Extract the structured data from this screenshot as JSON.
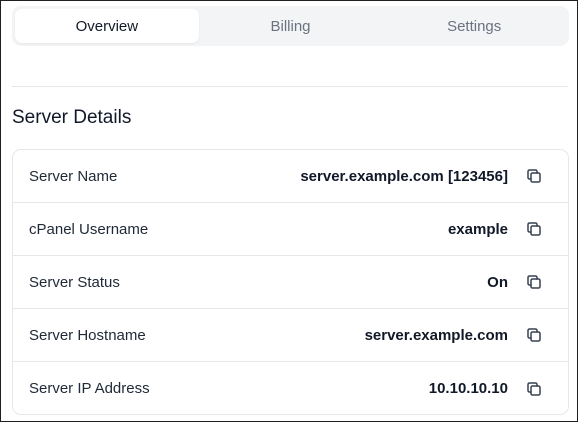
{
  "tabs": [
    {
      "label": "Overview",
      "active": true
    },
    {
      "label": "Billing",
      "active": false
    },
    {
      "label": "Settings",
      "active": false
    }
  ],
  "section": {
    "title": "Server Details"
  },
  "details": [
    {
      "label": "Server Name",
      "value": "server.example.com [123456]"
    },
    {
      "label": "cPanel Username",
      "value": "example"
    },
    {
      "label": "Server Status",
      "value": "On"
    },
    {
      "label": "Server Hostname",
      "value": "server.example.com"
    },
    {
      "label": "Server IP Address",
      "value": "10.10.10.10"
    }
  ],
  "icons": {
    "copy": "copy-icon"
  },
  "colors": {
    "tab_bar_bg": "#f3f4f6",
    "border": "#e5e7eb",
    "text": "#111827",
    "muted": "#6b7280"
  }
}
